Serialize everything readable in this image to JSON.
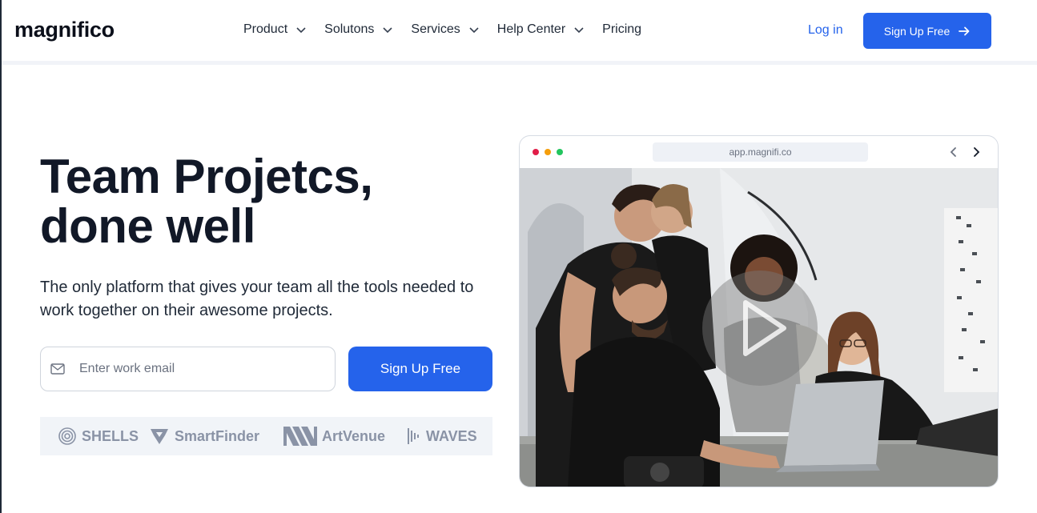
{
  "brand": "magnifico",
  "nav": {
    "items": [
      {
        "label": "Product",
        "dropdown": true
      },
      {
        "label": "Solutons",
        "dropdown": true
      },
      {
        "label": "Services",
        "dropdown": true
      },
      {
        "label": "Help Center",
        "dropdown": true
      },
      {
        "label": "Pricing",
        "dropdown": false
      }
    ],
    "login": "Log in",
    "cta": "Sign Up Free"
  },
  "hero": {
    "headline_line1": "Team Projetcs,",
    "headline_line2": "done well",
    "subtext": "The only platform that gives your team all the tools needed to work together on their awesome projects.",
    "email_placeholder": "Enter work email",
    "email_value": "",
    "cta": "Sign Up Free"
  },
  "partners": [
    "SHELLS",
    "SmartFinder",
    "ArtVenue",
    "WAVES"
  ],
  "browser": {
    "url": "app.magnifi.co",
    "dot_colors": [
      "#e11d48",
      "#f59e0b",
      "#22c55e"
    ]
  },
  "colors": {
    "accent": "#2563eb",
    "muted": "#8a93a6"
  }
}
